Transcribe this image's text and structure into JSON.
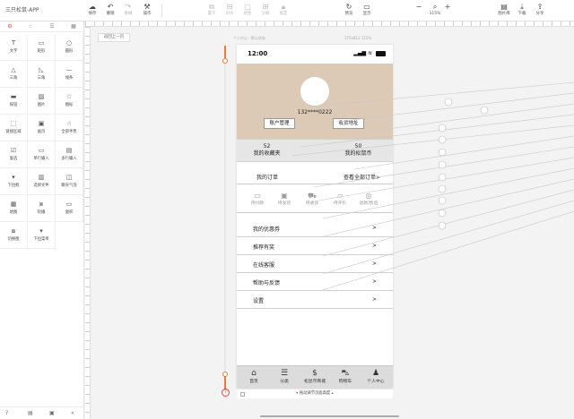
{
  "app": {
    "title": "三只松鼠-APP"
  },
  "toolbar": {
    "save": "保存",
    "undo": "撤销",
    "redo": "重做",
    "actions": "操作",
    "group1": [
      "置于",
      "对齐",
      "组合",
      "分解",
      "锁定"
    ],
    "preview": "预览",
    "show": "显示",
    "zoom": "115%",
    "lib": "图片库",
    "download": "下载",
    "share": "分享"
  },
  "left_panel": {
    "tabs": [
      "⚙",
      "☝",
      "☰",
      "▦"
    ],
    "widgets": [
      "文字",
      "矩形",
      "圆形",
      "三角",
      "三角",
      "线条",
      "按钮",
      "图片",
      "图标",
      "链接区域",
      "画页",
      "全部手势",
      "复选",
      "单行输入",
      "多行输入",
      "下拉框",
      "选择文件",
      "聊天气泡",
      "地图",
      "轮播",
      "面积",
      "切换图",
      "下拉菜单"
    ],
    "footer": [
      "?",
      "▤",
      "▣",
      "«"
    ]
  },
  "canvas": {
    "back_button": "返回上一页",
    "page_caption": "个人中心 · 默认状态",
    "page_size": "375x812 115%",
    "footer_hint": "拖动调节页面高度"
  },
  "phone": {
    "time": "12:00",
    "phone_number": "132****0222",
    "btn_account": "账户管理",
    "btn_address": "收货地址",
    "favorites_count": "52",
    "favorites_label": "我的收藏夹",
    "coins_count": "50",
    "coins_label": "我的松鼠币",
    "my_orders": "我的订单",
    "all_orders": "查看全部订单>",
    "order_icons": [
      {
        "label": "待付款",
        "icon": "wallet-icon",
        "glyph": "▭"
      },
      {
        "label": "待发货",
        "icon": "box-icon",
        "glyph": "▣"
      },
      {
        "label": "待收货",
        "icon": "truck-icon",
        "glyph": "⛟"
      },
      {
        "label": "待评价",
        "icon": "comment-icon",
        "glyph": "▱"
      },
      {
        "label": "退款/售后",
        "icon": "refund-icon",
        "glyph": "◎"
      }
    ],
    "menu": [
      {
        "label": "我的优惠券",
        "arrow": ">"
      },
      {
        "label": "推荐有奖",
        "arrow": ">"
      },
      {
        "label": "在线客服",
        "arrow": ">"
      },
      {
        "label": "帮助与反馈",
        "arrow": ">"
      },
      {
        "label": "设置",
        "arrow": ">"
      }
    ],
    "tabs": [
      {
        "label": "首页",
        "icon": "home-icon",
        "glyph": "⌂"
      },
      {
        "label": "分类",
        "icon": "list-icon",
        "glyph": "☰"
      },
      {
        "label": "松鼠币商城",
        "icon": "coin-icon",
        "glyph": "$"
      },
      {
        "label": "购物车",
        "icon": "cart-icon",
        "glyph": "⛍"
      },
      {
        "label": "个人中心",
        "icon": "user-icon",
        "glyph": "♟"
      }
    ]
  },
  "colors": {
    "profile_bg": "#dccab7",
    "accent": "#e87b3c",
    "brand_red": "#e04a3a"
  }
}
